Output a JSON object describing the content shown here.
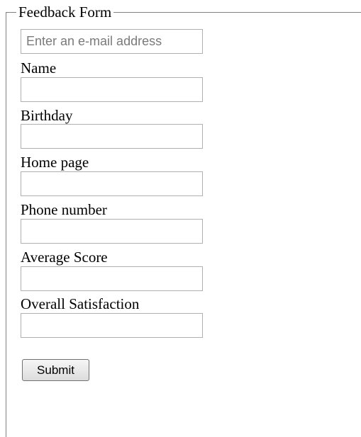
{
  "form": {
    "legend": "Feedback Form",
    "email": {
      "placeholder": "Enter an e-mail address",
      "value": ""
    },
    "fields": [
      {
        "label": "Name",
        "value": ""
      },
      {
        "label": "Birthday",
        "value": ""
      },
      {
        "label": "Home page",
        "value": ""
      },
      {
        "label": "Phone number",
        "value": ""
      },
      {
        "label": "Average Score",
        "value": ""
      },
      {
        "label": "Overall Satisfaction",
        "value": ""
      }
    ],
    "submit_label": "Submit"
  },
  "colors": {
    "border": "#808080",
    "input_border": "#b0b0b0",
    "placeholder": "#7a7a7a",
    "background": "#ffffff"
  }
}
